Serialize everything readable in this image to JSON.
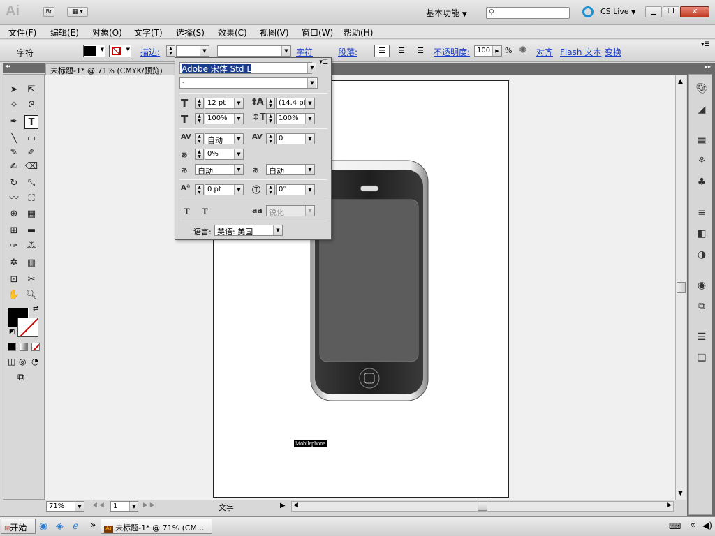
{
  "app": {
    "logo": "Ai",
    "bridge_label": "Br",
    "workspace": "基本功能",
    "search_placeholder": "",
    "cs_live": "CS Live"
  },
  "menu": [
    "文件(F)",
    "编辑(E)",
    "对象(O)",
    "文字(T)",
    "选择(S)",
    "效果(C)",
    "视图(V)",
    "窗口(W)",
    "帮助(H)"
  ],
  "control_bar": {
    "label": "字符",
    "stroke_link": "描边:",
    "char_link": "字符",
    "para_link": "段落:",
    "opacity_link": "不透明度:",
    "opacity_value": "100",
    "opacity_unit": "%",
    "align_link": "对齐",
    "flash_text_link": "Flash 文本",
    "transform_link": "变换"
  },
  "document": {
    "tab_title": "未标题-1* @ 71% (CMYK/预览)",
    "text_object": "Mobilephone"
  },
  "char_panel": {
    "font_family": "Adobe 宋体 Std L",
    "font_style": "-",
    "font_size": "12 pt",
    "leading": "(14.4 pt)",
    "vscale": "100%",
    "hscale": "100%",
    "kerning": "自动",
    "tracking": "0",
    "tsume": "0%",
    "aki_left": "自动",
    "aki_right": "自动",
    "baseline": "0 pt",
    "rotation": "0°",
    "antialias": "锐化",
    "language_label": "语言:",
    "language": "英语: 美国"
  },
  "status": {
    "zoom": "71%",
    "page": "1",
    "tool_label": "文字"
  },
  "taskbar": {
    "start": "开始",
    "task": "未标题-1* @ 71% (CM..."
  }
}
